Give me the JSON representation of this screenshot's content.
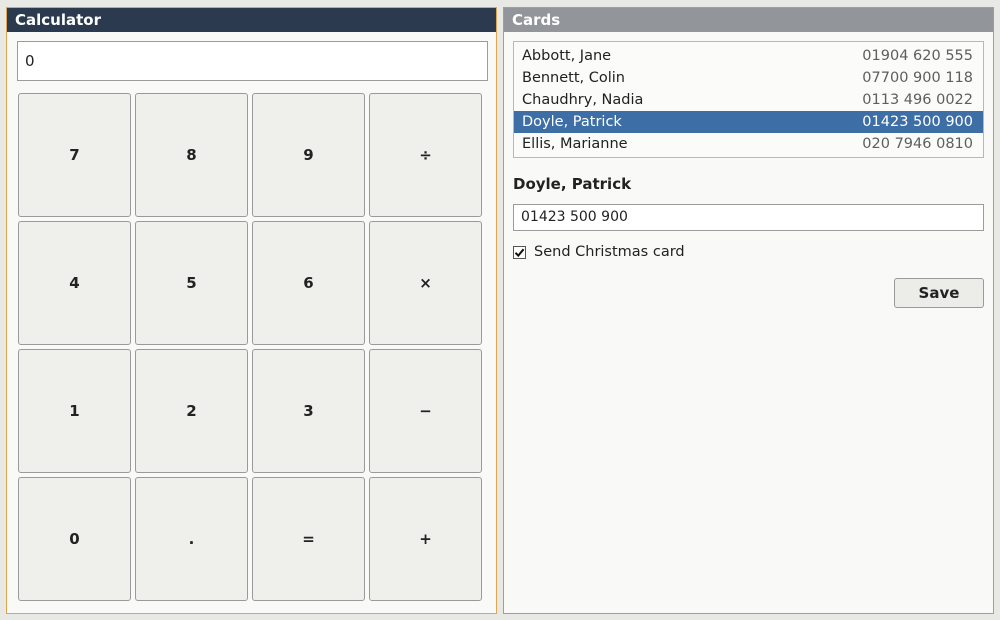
{
  "calculator": {
    "title": "Calculator",
    "display_value": "0",
    "keys": [
      "7",
      "8",
      "9",
      "÷",
      "4",
      "5",
      "6",
      "×",
      "1",
      "2",
      "3",
      "−",
      "0",
      ".",
      "=",
      "+"
    ]
  },
  "cards": {
    "title": "Cards",
    "contacts": [
      {
        "name": "Abbott, Jane",
        "phone": "01904 620 555"
      },
      {
        "name": "Bennett, Colin",
        "phone": "07700 900 118"
      },
      {
        "name": "Chaudhry, Nadia",
        "phone": "0113 496 0022"
      },
      {
        "name": "Doyle, Patrick",
        "phone": "01423 500 900"
      },
      {
        "name": "Ellis, Marianne",
        "phone": "020 7946 0810"
      }
    ],
    "selected_index": 3,
    "detail": {
      "name": "Doyle, Patrick",
      "phone_value": "01423 500 900",
      "christmas_label": "Send Christmas card",
      "christmas_checked": true,
      "save_label": "Save"
    }
  },
  "colors": {
    "calc_title_bg": "#2b3a4f",
    "calc_focus_border": "#e0a54e",
    "cards_title_bg": "#92959a",
    "selection": "#3d6ea6"
  }
}
